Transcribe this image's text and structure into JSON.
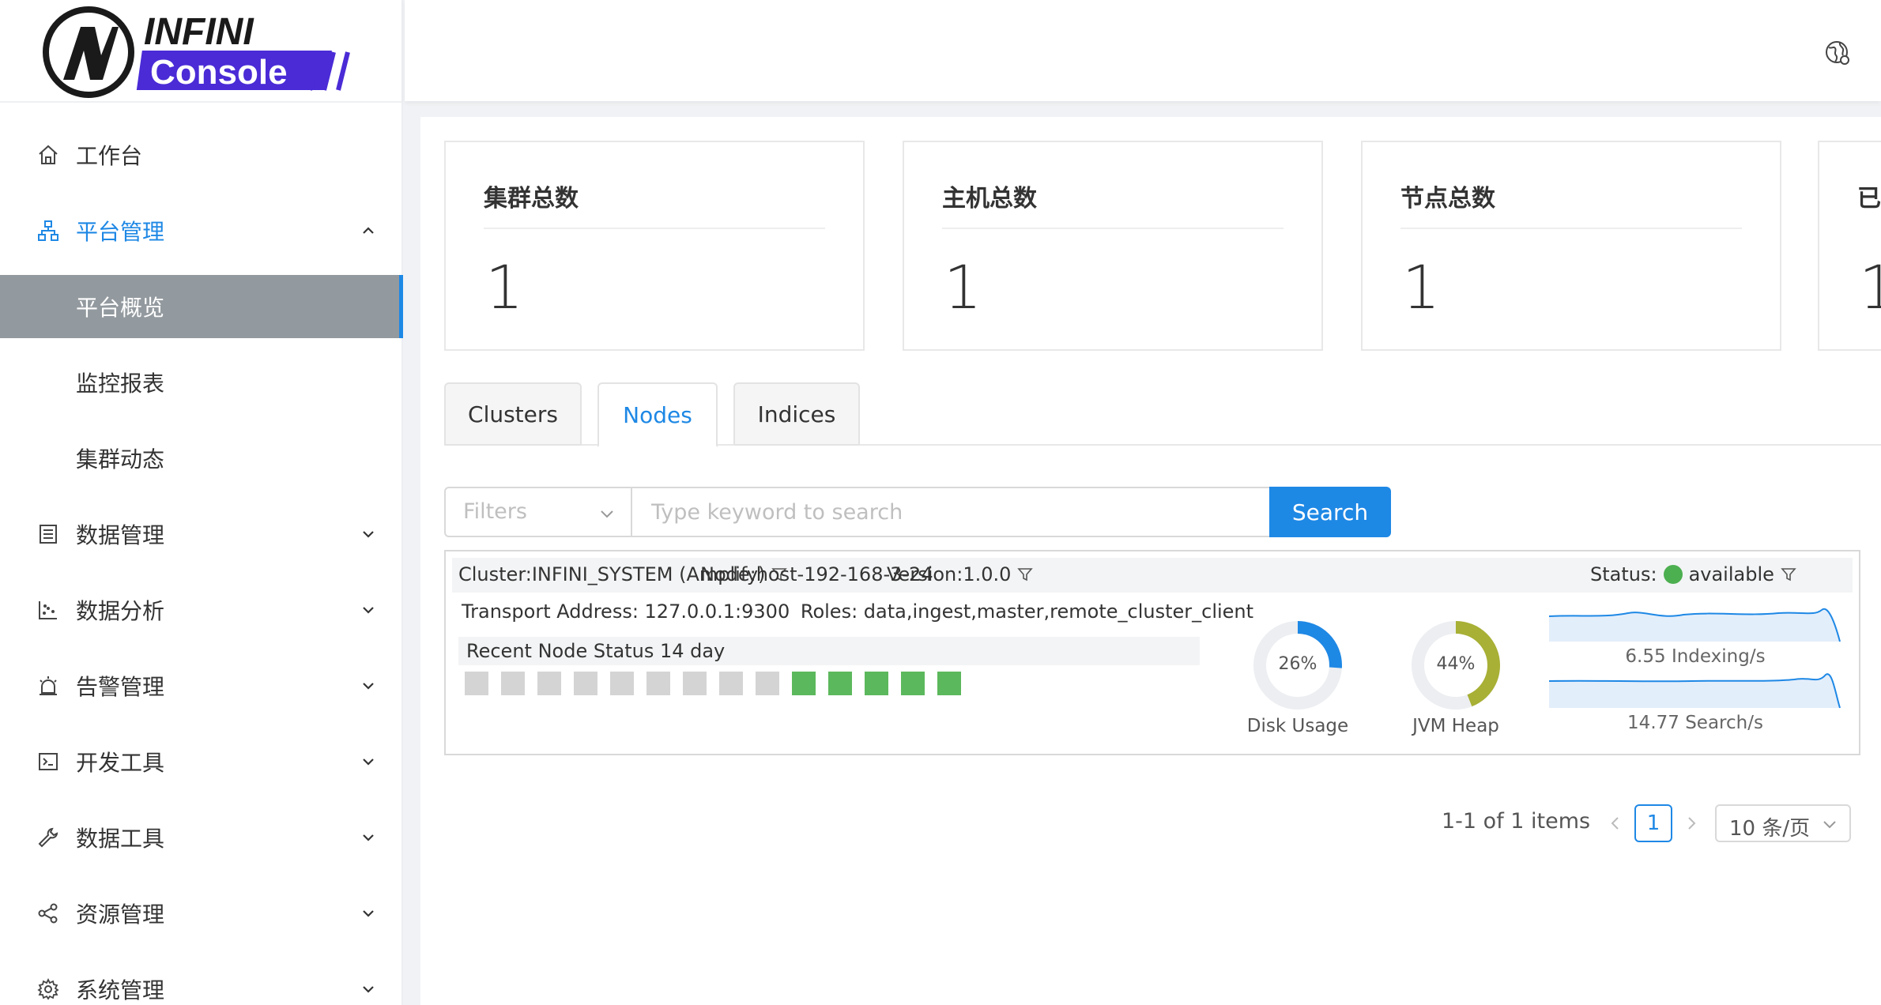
{
  "app": {
    "logo_top": "INFINI",
    "logo_bottom": "Console",
    "brand_color": "#4a2bd6"
  },
  "sidebar": {
    "items": [
      {
        "label": "工作台",
        "icon": "home-icon"
      },
      {
        "label": "平台管理",
        "icon": "sitemap-icon",
        "expanded": true
      },
      {
        "label": "数据管理",
        "icon": "database-icon"
      },
      {
        "label": "数据分析",
        "icon": "chart-icon"
      },
      {
        "label": "告警管理",
        "icon": "alarm-icon"
      },
      {
        "label": "开发工具",
        "icon": "terminal-icon"
      },
      {
        "label": "数据工具",
        "icon": "wrench-icon"
      },
      {
        "label": "资源管理",
        "icon": "share-icon"
      },
      {
        "label": "系统管理",
        "icon": "gear-icon"
      }
    ],
    "submenu": [
      {
        "label": "平台概览",
        "selected": true
      },
      {
        "label": "监控报表"
      },
      {
        "label": "集群动态"
      }
    ]
  },
  "stats": [
    {
      "title": "集群总数",
      "value": "1"
    },
    {
      "title": "主机总数",
      "value": "1"
    },
    {
      "title": "节点总数",
      "value": "1"
    },
    {
      "title": "已",
      "value": "1"
    }
  ],
  "tabs": [
    {
      "label": "Clusters"
    },
    {
      "label": "Nodes",
      "active": true
    },
    {
      "label": "Indices"
    }
  ],
  "search": {
    "filters_placeholder": "Filters",
    "placeholder": "Type keyword to search",
    "button": "Search"
  },
  "node": {
    "cluster": "Cluster:INFINI_SYSTEM (Amplify)",
    "node_name": "Node:host-192-168-3-24",
    "version": "Version:1.0.0",
    "status_label": "Status:",
    "status_value": "available",
    "transport": "Transport Address: 127.0.0.1:9300",
    "roles": "Roles: data,ingest,master,remote_cluster_client",
    "recent_title": "Recent Node Status 14 day",
    "recent_status": [
      "gray",
      "gray",
      "gray",
      "gray",
      "gray",
      "gray",
      "gray",
      "gray",
      "gray",
      "green",
      "green",
      "green",
      "green",
      "green"
    ],
    "disk_usage": {
      "label": "Disk Usage",
      "percent_text": "26%",
      "percent": 26,
      "color": "#1e88e5"
    },
    "jvm_heap": {
      "label": "JVM Heap",
      "percent_text": "44%",
      "percent": 44,
      "color": "#a8b035"
    },
    "indexing": "6.55 Indexing/s",
    "search_rate": "14.77 Search/s"
  },
  "pagination": {
    "total": "1-1 of 1 items",
    "page": "1",
    "page_size": "10 条/页"
  }
}
